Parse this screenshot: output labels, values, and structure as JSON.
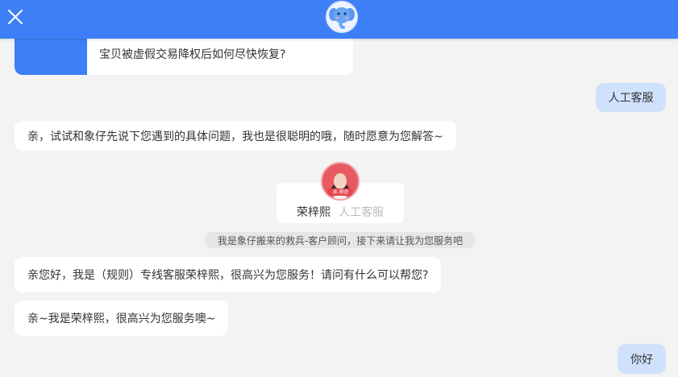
{
  "faq_card": {
    "question": "宝贝被虚假交易降权后如何尽快恢复?"
  },
  "messages": {
    "user_1": "人工客服",
    "bot_1": "亲，试试和象仔先说下您遇到的具体问题，我也是很聪明的哦，随时愿意为您解答~",
    "agent_intro_name": "荣梓熙",
    "agent_intro_role": "人工客服",
    "agent_avatar_badge": "亲,购在",
    "system_note": "我是象仔搬来的救兵-客户顾问，接下来请让我为您服务吧",
    "agent_1": "亲您好，我是（规则）专线客服荣梓熙，很高兴为您服务！请问有什么可以帮您?",
    "agent_2": "亲~我是荣梓熙，很高兴为您服务噢~",
    "user_2": "你好"
  },
  "colors": {
    "topbar": "#3d7ff7",
    "user_bubble": "#cfe1fb",
    "background": "#f3f3f3"
  },
  "icons": {
    "close": "close-icon",
    "logo": "elephant-logo-icon"
  }
}
